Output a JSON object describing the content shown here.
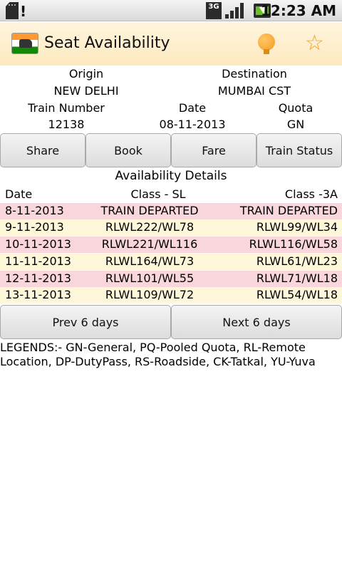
{
  "status_bar": {
    "time": "12:23 AM",
    "network_label": "3G",
    "icons": [
      "sd-card-icon",
      "alert-icon",
      "3g-icon",
      "signal-icon",
      "battery-charging-icon"
    ]
  },
  "title_bar": {
    "title": "Seat Availability",
    "icons": [
      "train-logo-icon",
      "bulb-icon",
      "star-icon"
    ],
    "accent_color": "#f4a021"
  },
  "train_info": {
    "origin_label": "Origin",
    "origin_value": "NEW DELHI",
    "destination_label": "Destination",
    "destination_value": "MUMBAI CST",
    "train_number_label": "Train Number",
    "train_number_value": "12138",
    "date_label": "Date",
    "date_value": "08-11-2013",
    "quota_label": "Quota",
    "quota_value": "GN"
  },
  "actions": {
    "share": "Share",
    "book": "Book",
    "fare": "Fare",
    "train_status": "Train Status"
  },
  "availability": {
    "title": "Availability Details",
    "headers": {
      "date": "Date",
      "class_sl": "Class - SL",
      "class_3a": "Class -3A"
    },
    "rows": [
      {
        "date": "8-11-2013",
        "sl": "TRAIN DEPARTED",
        "ac3": "TRAIN DEPARTED",
        "color": "#f8d6dc"
      },
      {
        "date": "9-11-2013",
        "sl": "RLWL222/WL78",
        "ac3": "RLWL99/WL34",
        "color": "#fdf6d8"
      },
      {
        "date": "10-11-2013",
        "sl": "RLWL221/WL116",
        "ac3": "RLWL116/WL58",
        "color": "#f8d6dc"
      },
      {
        "date": "11-11-2013",
        "sl": "RLWL164/WL73",
        "ac3": "RLWL61/WL23",
        "color": "#fdf6d8"
      },
      {
        "date": "12-11-2013",
        "sl": "RLWL101/WL55",
        "ac3": "RLWL71/WL18",
        "color": "#f8d6dc"
      },
      {
        "date": "13-11-2013",
        "sl": "RLWL109/WL72",
        "ac3": "RLWL54/WL18",
        "color": "#fdf6d8"
      }
    ]
  },
  "navigation": {
    "prev": "Prev 6 days",
    "next": "Next 6 days"
  },
  "legend": {
    "line1": "LEGENDS:- GN-General, PQ-Pooled Quota, RL-Remote",
    "line2": "Location, DP-DutyPass, RS-Roadside, CK-Tatkal, YU-Yuva"
  }
}
